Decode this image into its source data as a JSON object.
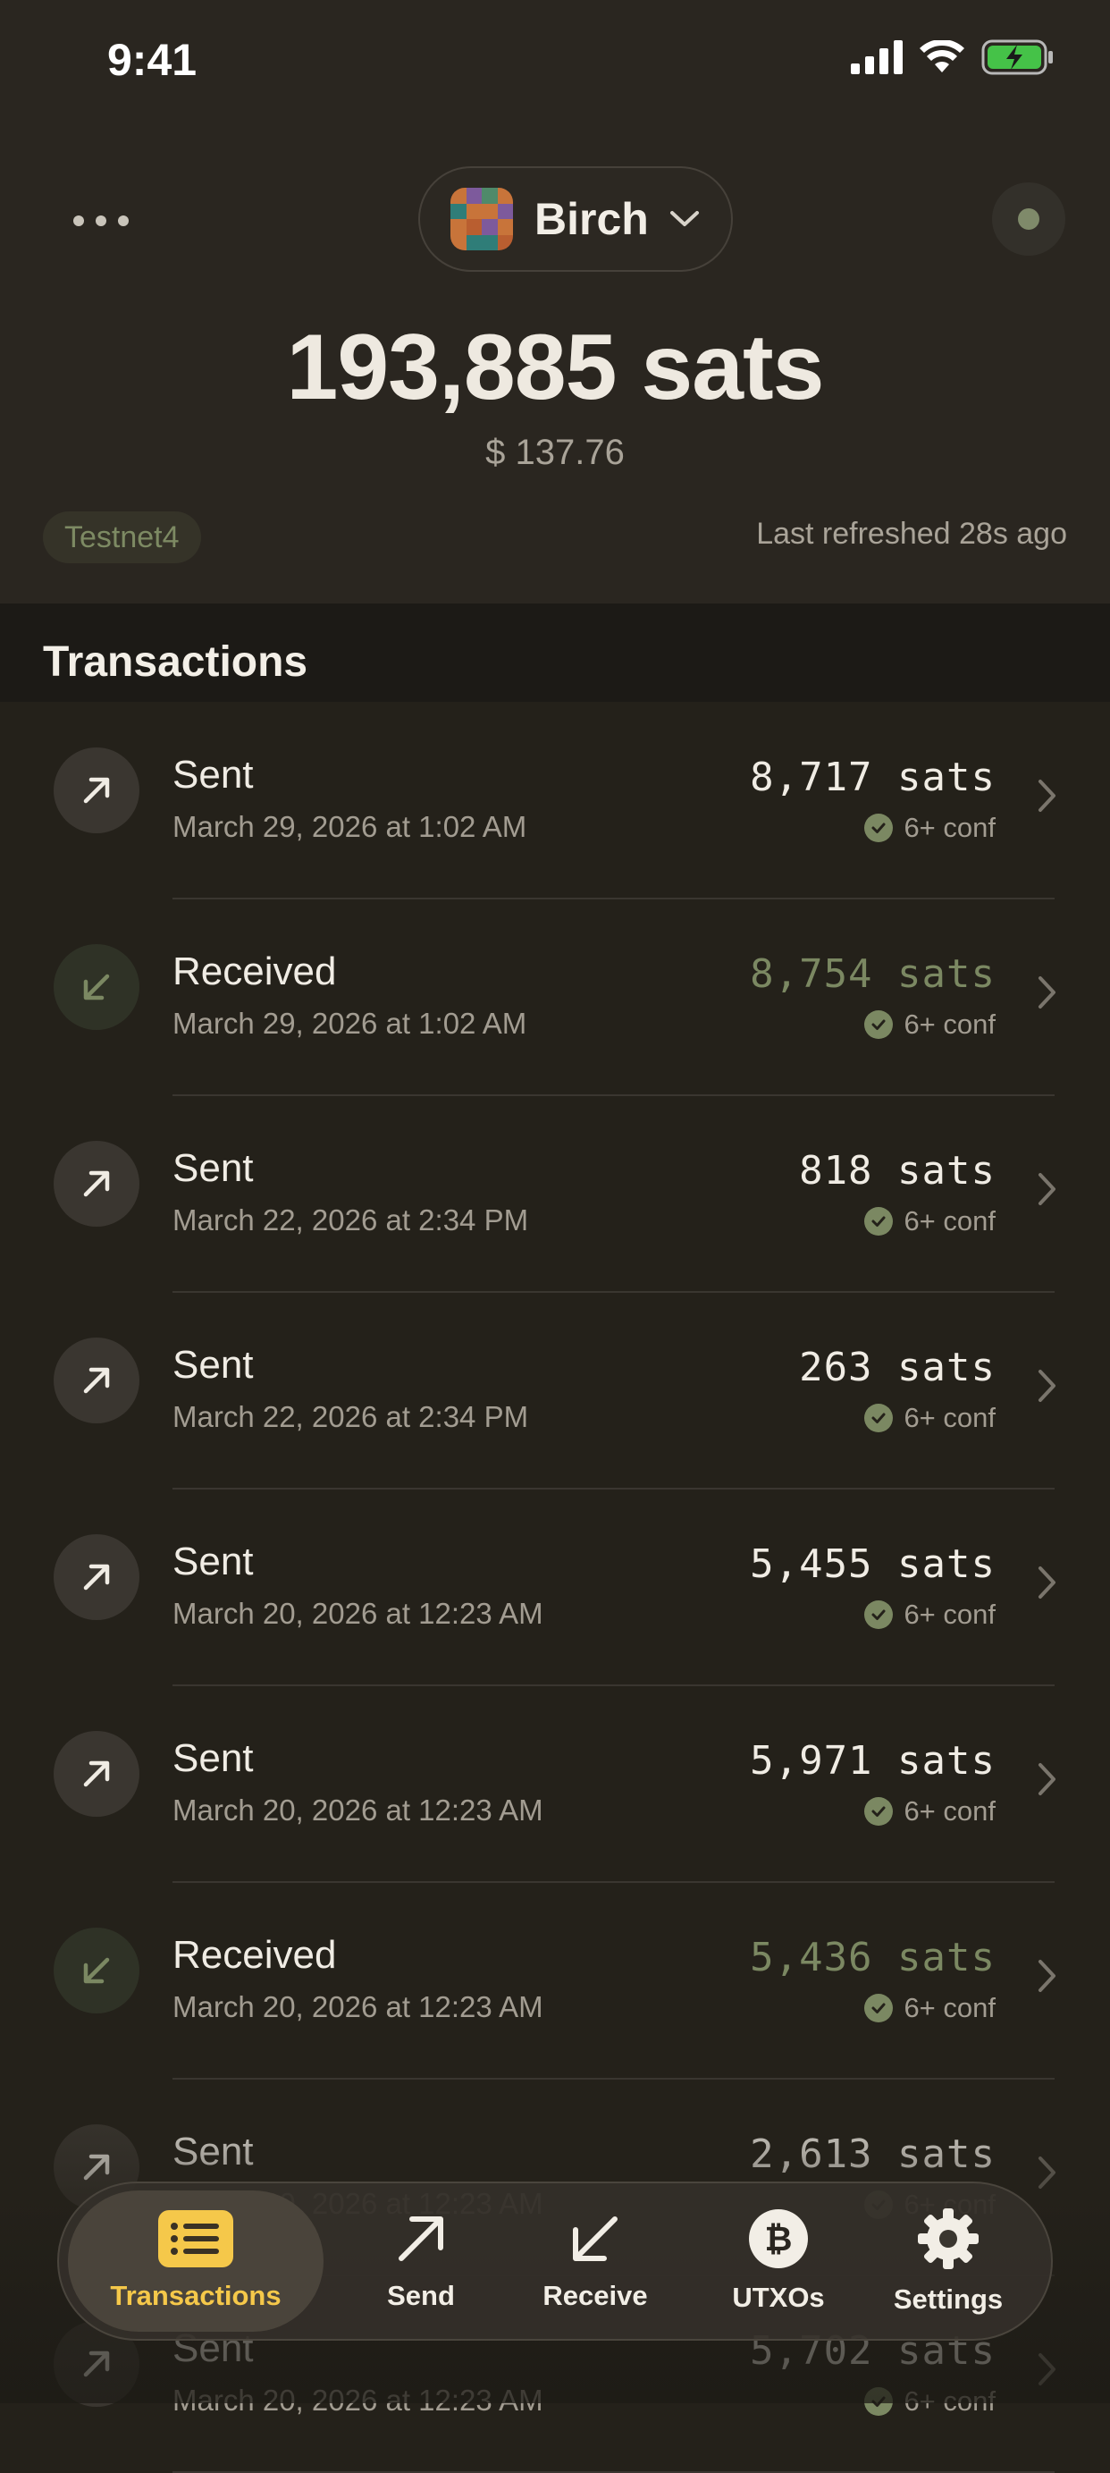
{
  "status_bar": {
    "time": "9:41"
  },
  "header": {
    "wallet_name": "Birch",
    "balance": "193,885 sats",
    "fiat_balance": "$ 137.76",
    "network": "Testnet4",
    "last_refreshed": "Last refreshed 28s ago"
  },
  "section": {
    "title": "Transactions"
  },
  "transactions": [
    {
      "type": "Sent",
      "date": "March 29, 2026 at 1:02 AM",
      "amount": "8,717 sats",
      "conf": "6+ conf",
      "direction": "sent"
    },
    {
      "type": "Received",
      "date": "March 29, 2026 at 1:02 AM",
      "amount": "8,754 sats",
      "conf": "6+ conf",
      "direction": "received"
    },
    {
      "type": "Sent",
      "date": "March 22, 2026 at 2:34 PM",
      "amount": "818 sats",
      "conf": "6+ conf",
      "direction": "sent"
    },
    {
      "type": "Sent",
      "date": "March 22, 2026 at 2:34 PM",
      "amount": "263 sats",
      "conf": "6+ conf",
      "direction": "sent"
    },
    {
      "type": "Sent",
      "date": "March 20, 2026 at 12:23 AM",
      "amount": "5,455 sats",
      "conf": "6+ conf",
      "direction": "sent"
    },
    {
      "type": "Sent",
      "date": "March 20, 2026 at 12:23 AM",
      "amount": "5,971 sats",
      "conf": "6+ conf",
      "direction": "sent"
    },
    {
      "type": "Received",
      "date": "March 20, 2026 at 12:23 AM",
      "amount": "5,436 sats",
      "conf": "6+ conf",
      "direction": "received"
    },
    {
      "type": "Sent",
      "date": "March 20, 2026 at 12:23 AM",
      "amount": "2,613 sats",
      "conf": "6+ conf",
      "direction": "sent"
    },
    {
      "type": "Sent",
      "date": "March 20, 2026 at 12:23 AM",
      "amount": "5,702 sats",
      "conf": "6+ conf",
      "direction": "sent"
    }
  ],
  "tab_bar": {
    "transactions": "Transactions",
    "send": "Send",
    "receive": "Receive",
    "utxos": "UTXOs",
    "settings": "Settings"
  },
  "colors": {
    "accent": "#f5c84a",
    "received_amount": "#7b8862",
    "background": "#24211a",
    "network_badge_text": "#7d8a63"
  },
  "icons": {
    "sent": "arrow-up-right-icon",
    "received": "arrow-down-left-icon",
    "confirmed": "check-circle-icon",
    "row_chevron": "chevron-right-icon"
  }
}
